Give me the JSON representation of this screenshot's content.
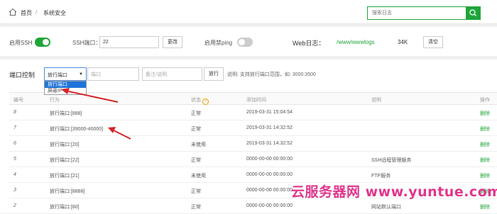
{
  "breadcrumb": {
    "home": "首页",
    "sep": "/",
    "current": "系统安全"
  },
  "search": {
    "placeholder": "搜索日志"
  },
  "ssh": {
    "enable_label": "启用SSH",
    "port_label": "SSH端口：",
    "port_value": "22",
    "change_btn": "更改",
    "ping_label": "启用禁ping"
  },
  "weblog": {
    "label": "Web日志：",
    "path": "/www/wwwlogs",
    "size": "34K",
    "clear_btn": "清空"
  },
  "port_control": {
    "label": "端口控制",
    "select_value": "放行端口",
    "options": [
      "放行端口",
      "屏蔽IP"
    ],
    "port_placeholder": "端口",
    "note_placeholder": "备注/说明",
    "submit_btn": "放行",
    "hint": "说明: 支持放行端口范围，如: 3000:3500"
  },
  "table": {
    "headers": {
      "id": "编号",
      "action": "行为",
      "status": "状态",
      "time": "添加时间",
      "note": "说明",
      "ops": "操作"
    },
    "rows": [
      {
        "id": "8",
        "action": "放行端口:[888]",
        "status": "正常",
        "time": "2019-03-31 15:04:54",
        "note": "",
        "op": "删除"
      },
      {
        "id": "7",
        "action": "放行端口:[39000-40000]",
        "status": "正常",
        "time": "2019-03-31 14:32:52",
        "note": "",
        "op": "删除"
      },
      {
        "id": "6",
        "action": "放行端口:[20]",
        "status": "未使用",
        "time": "2019-03-31 14:32:52",
        "note": "",
        "op": "删除"
      },
      {
        "id": "5",
        "action": "放行端口:[22]",
        "status": "正常",
        "time": "0000-00-00 00:00:00",
        "note": "SSH远程管理服务",
        "op": "删除"
      },
      {
        "id": "4",
        "action": "放行端口:[21]",
        "status": "未使用",
        "time": "0000-00-00 00:00:00",
        "note": "FTP服务",
        "op": "删除"
      },
      {
        "id": "3",
        "action": "放行端口:[8888]",
        "status": "正常",
        "time": "0000-00-00 00:00:00",
        "note": "",
        "op": "删除"
      },
      {
        "id": "2",
        "action": "放行端口:[80]",
        "status": "正常",
        "time": "0000-00-00 00:00:00",
        "note": "网站默认端口",
        "op": "删除"
      }
    ]
  },
  "watermark": "云服务器网 www.yuntue.com",
  "colors": {
    "accent": "#20a53a",
    "select_border": "#4a90e2",
    "option_selected": "#1e74d9",
    "arrow": "#d7262b",
    "watermark": "#e0368c"
  },
  "icons": {
    "home": "home-icon",
    "search": "search-icon",
    "help": "help-icon"
  }
}
